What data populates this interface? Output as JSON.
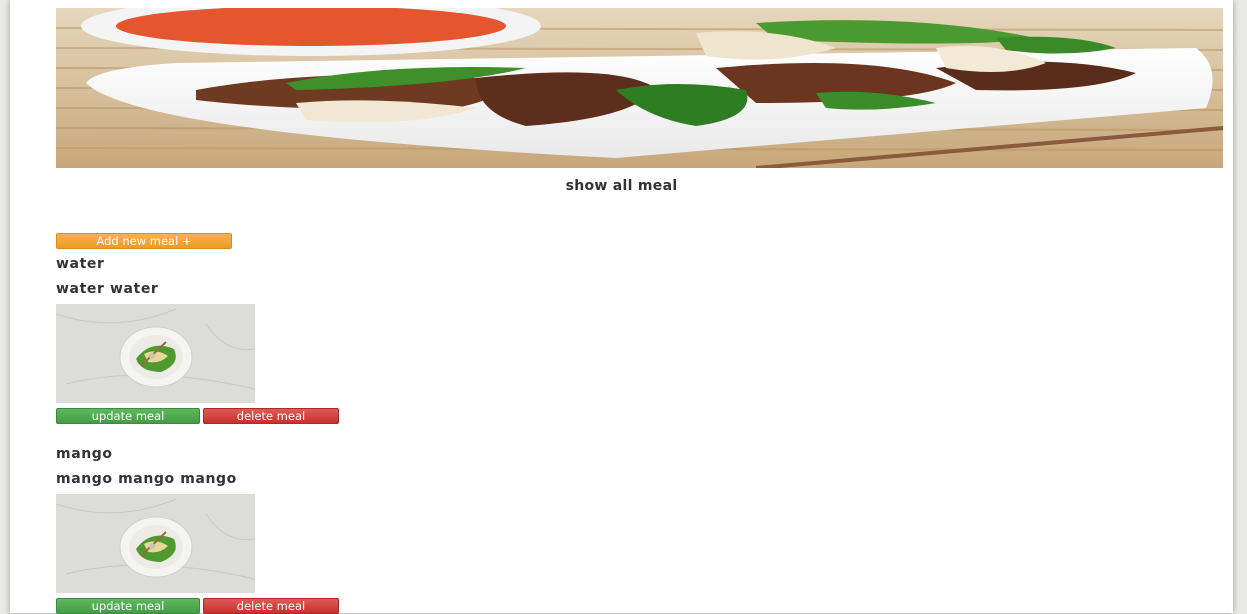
{
  "page": {
    "title": "show all meal"
  },
  "toolbar": {
    "add_label": "Add new meal +"
  },
  "meals": [
    {
      "name": "water",
      "description": "water water",
      "update_label": "update meal",
      "delete_label": "delete meal"
    },
    {
      "name": "mango",
      "description": "mango mango mango",
      "update_label": "update meal",
      "delete_label": "delete meal"
    }
  ],
  "colors": {
    "add_button": "#f0a030",
    "update_button": "#4cae4c",
    "delete_button": "#d9534f",
    "text": "#333333"
  }
}
